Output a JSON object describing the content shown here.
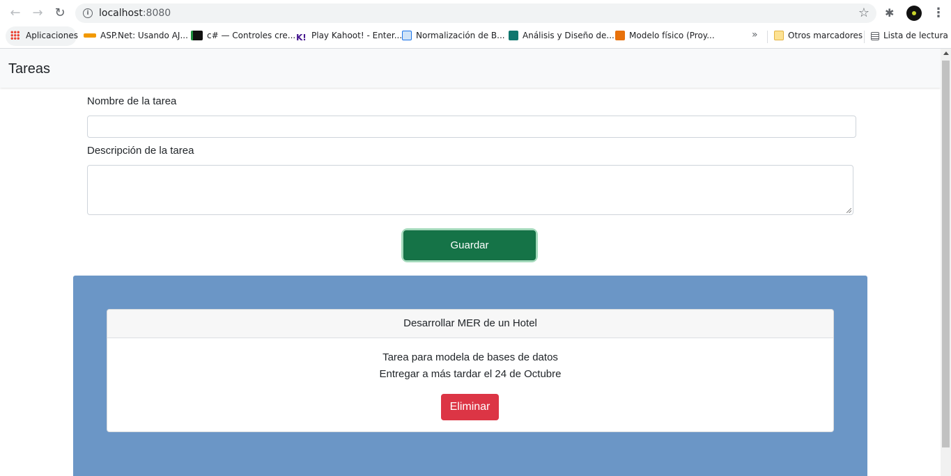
{
  "browser": {
    "url_host": "localhost",
    "url_port": ":8080",
    "bookmarks": [
      {
        "label": "Aplicaciones",
        "color": "#ea4335"
      },
      {
        "label": "ASP.Net: Usando AJ...",
        "color": "#f29900"
      },
      {
        "label": "c# — Controles cre...",
        "color": "#1e8e3e"
      },
      {
        "label": "Play Kahoot! - Enter...",
        "color": "#46178f"
      },
      {
        "label": "Normalización de B...",
        "color": "#1a73e8"
      },
      {
        "label": "Análisis y Diseño de...",
        "color": "#0f766e"
      },
      {
        "label": "Modelo físico (Proy...",
        "color": "#e8710a"
      }
    ],
    "other_bookmarks": "Otros marcadores",
    "reading_list": "Lista de lectura"
  },
  "navbar": {
    "brand": "Tareas"
  },
  "form": {
    "name_label": "Nombre de la tarea",
    "name_value": "",
    "description_label": "Descripción de la tarea",
    "description_value": "",
    "save_label": "Guardar"
  },
  "tasks": [
    {
      "title": "Desarrollar MER de un Hotel",
      "line1": "Tarea para modela de bases de datos",
      "line2": "Entregar a más tardar el 24 de Octubre",
      "delete_label": "Eliminar"
    }
  ],
  "colors": {
    "panel_bg": "#6b96c6",
    "save_button": "#157347",
    "delete_button": "#dc3545"
  }
}
